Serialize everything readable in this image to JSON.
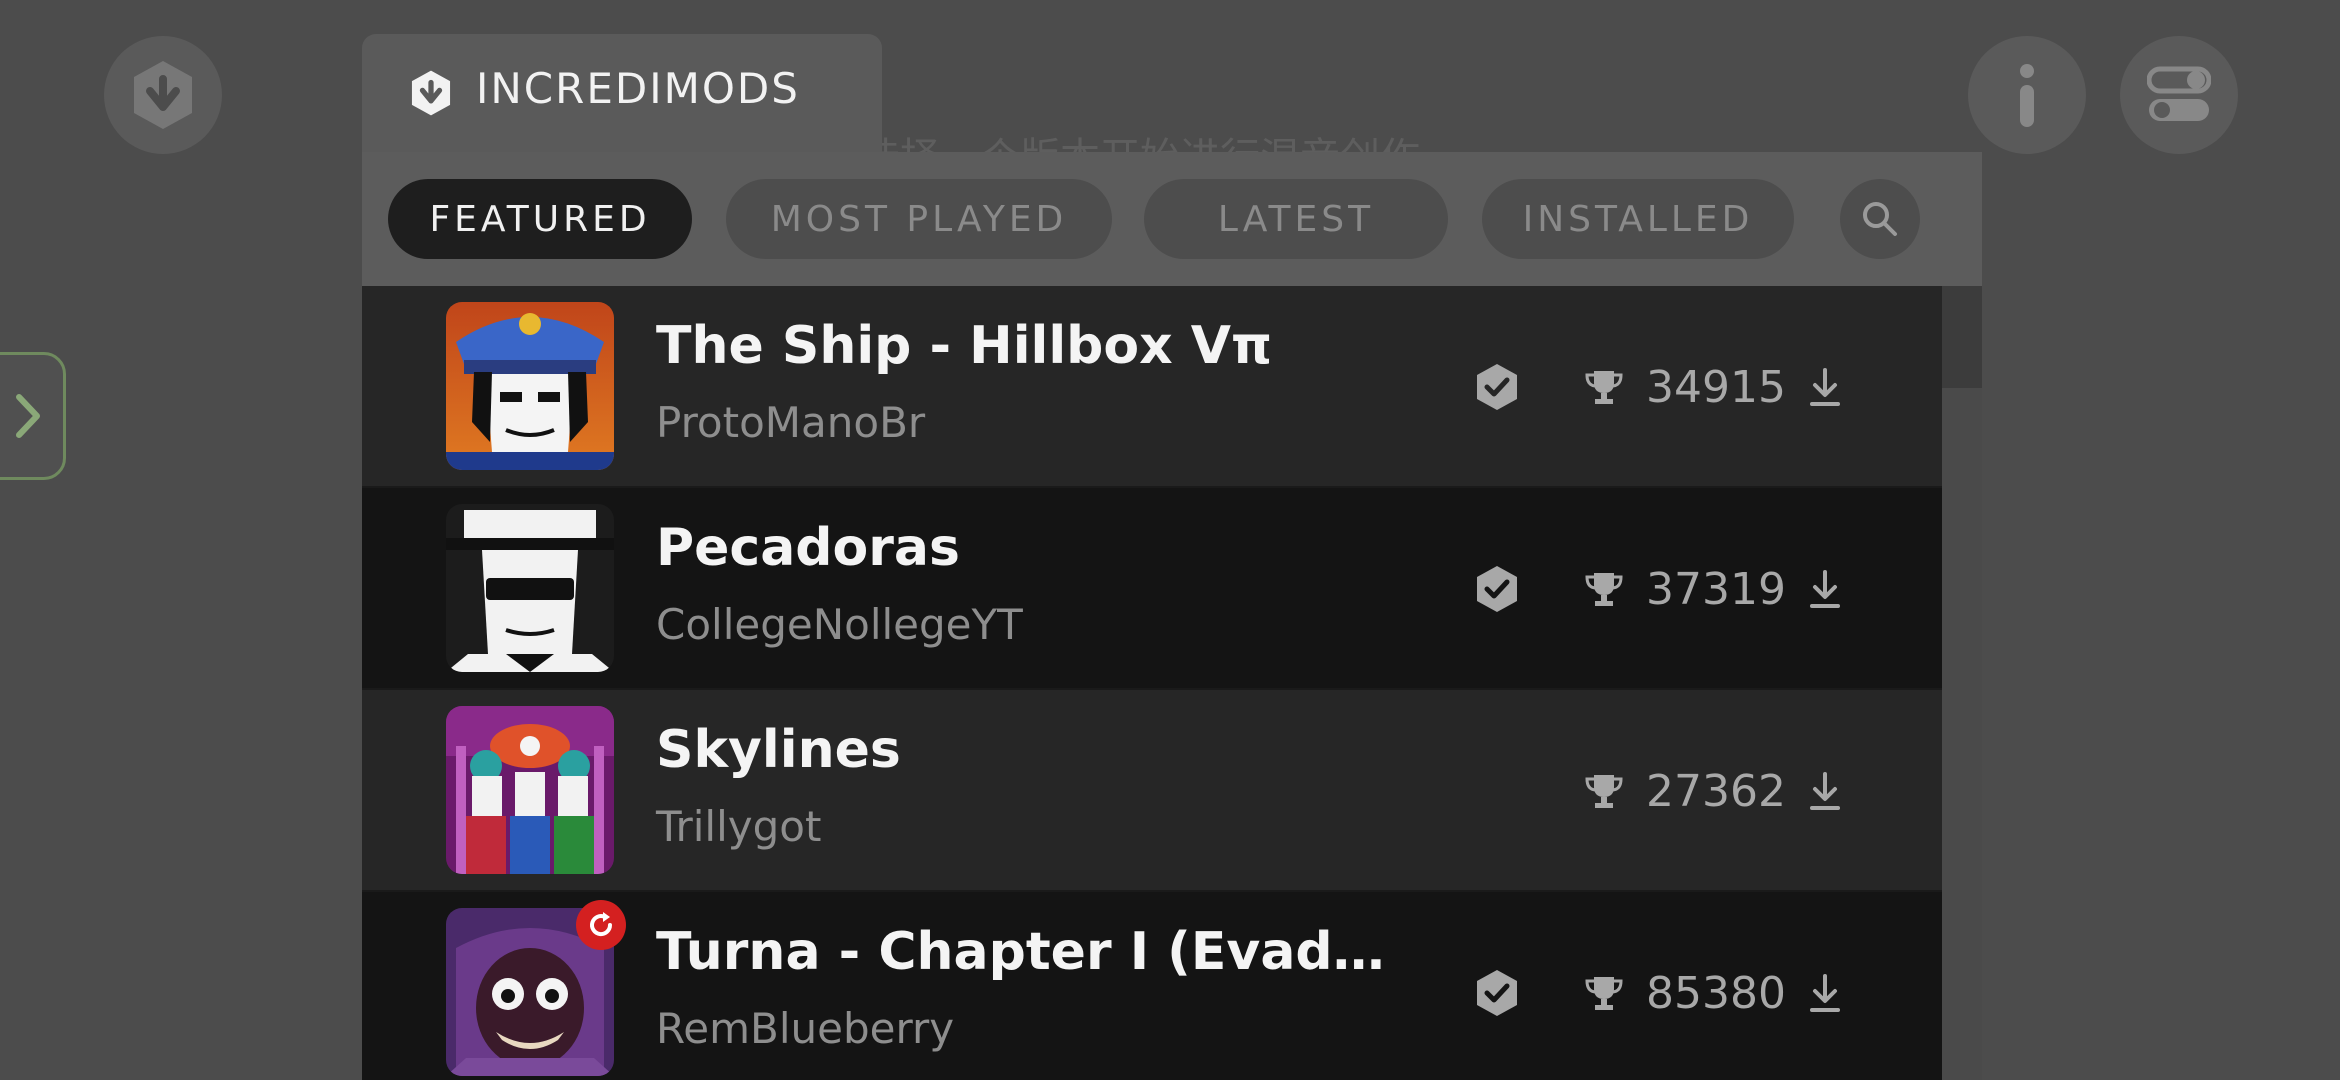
{
  "background_text": "选择一个版本开始进行混音创作",
  "header": {
    "title": "INCREDIMODS"
  },
  "filters": {
    "featured": "FEATURED",
    "most_played": "MOST PLAYED",
    "latest": "LATEST",
    "installed": "INSTALLED",
    "active": "featured"
  },
  "mods": [
    {
      "name": "The Ship - Hillbox Vπ",
      "author": "ProtoManoBr",
      "plays": "34915",
      "verified": true,
      "update_badge": false
    },
    {
      "name": "Pecadoras",
      "author": "CollegeNollegeYT",
      "plays": "37319",
      "verified": true,
      "update_badge": false
    },
    {
      "name": "Skylines",
      "author": "Trillygot",
      "plays": "27362",
      "verified": false,
      "update_badge": false
    },
    {
      "name": "Turna - Chapter I (Evadare Reanimated)",
      "author": "RemBlueberry",
      "plays": "85380",
      "verified": true,
      "update_badge": true
    }
  ],
  "colors": {
    "background": "#4c4c4c",
    "active_pill": "#1e1e1e",
    "toggle_border": "#6f8a5e",
    "update_badge": "#d42020"
  }
}
